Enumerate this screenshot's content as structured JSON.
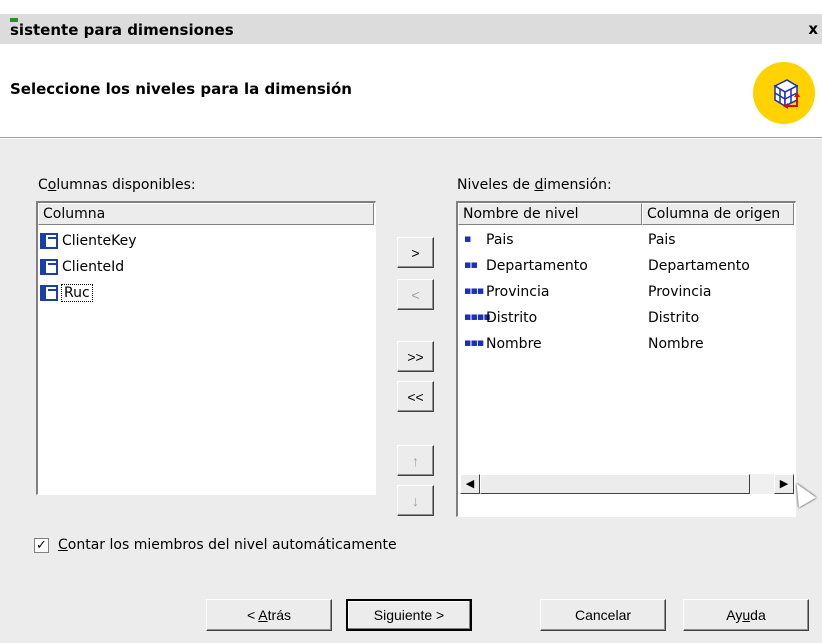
{
  "window": {
    "title": "sistente para dimensiones",
    "close_label": "x"
  },
  "header": {
    "subtitle": "Seleccione los niveles para la dimensión"
  },
  "available": {
    "label_pre": "C",
    "label_ul": "o",
    "label_post": "lumnas disponibles:",
    "column_header": "Columna",
    "items": [
      "ClienteKey",
      "ClienteId",
      "Ruc"
    ]
  },
  "levels": {
    "label_pre": "Niveles de ",
    "label_ul": "d",
    "label_post": "imensión:",
    "header_name": "Nombre de nivel",
    "header_source": "Columna de origen",
    "rows": [
      {
        "marker": "▪",
        "name": "Pais",
        "source": "Pais"
      },
      {
        "marker": "▪▪",
        "name": "Departamento",
        "source": "Departamento"
      },
      {
        "marker": "▪▪▪",
        "name": "Provincia",
        "source": "Provincia"
      },
      {
        "marker": "▪▪▪▪",
        "name": "Distrito",
        "source": "Distrito"
      },
      {
        "marker": "▪▪▪",
        "name": "Nombre",
        "source": "Nombre"
      }
    ]
  },
  "move_buttons": {
    "add": ">",
    "remove": "<",
    "add_all": ">>",
    "remove_all": "<<",
    "up": "↑",
    "down": "↓"
  },
  "checkbox": {
    "checked_mark": "✓",
    "label_ul": "C",
    "label_post": "ontar los miembros del nivel automáticamente"
  },
  "footer": {
    "back_pre": "< ",
    "back_ul": "A",
    "back_post": "trás",
    "next": "Siguiente >",
    "cancel": "Cancelar",
    "help_pre": "Ay",
    "help_ul": "u",
    "help_post": "da"
  },
  "scroll": {
    "left_arrow": "◀",
    "right_arrow": "▶"
  }
}
